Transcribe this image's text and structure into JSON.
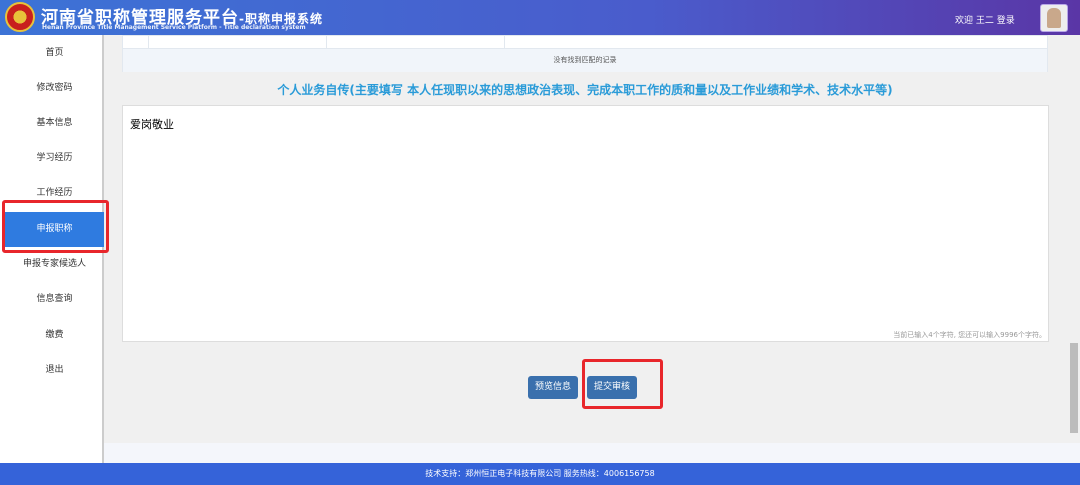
{
  "header": {
    "title": "河南省职称管理服务平台",
    "subtitle_system": "-职称申报系统",
    "english": "Henan Province Title Management Service Platform - Title declaration system",
    "welcome": "欢迎 王二 登录"
  },
  "sidebar": {
    "items": [
      {
        "label": "首页"
      },
      {
        "label": "修改密码"
      },
      {
        "label": "基本信息"
      },
      {
        "label": "学习经历"
      },
      {
        "label": "工作经历"
      },
      {
        "label": "申报职称"
      },
      {
        "label": "申报专家候选人"
      },
      {
        "label": "信息查询"
      },
      {
        "label": "缴费"
      },
      {
        "label": "退出"
      }
    ],
    "active": "申报职称"
  },
  "table": {
    "empty_text": "没有找到匹配的记录"
  },
  "section": {
    "title": "个人业务自传(主要填写 本人任现职以来的思想政治表现、完成本职工作的质和量以及工作业绩和学术、技术水平等)",
    "content": "爱岗敬业",
    "counter": "当前已输入4个字符, 您还可以输入9996个字符。"
  },
  "buttons": {
    "preview": "预览信息",
    "submit": "提交审核"
  },
  "footer": {
    "text": "技术支持：郑州恒正电子科技有限公司 服务热线：4006156758"
  }
}
